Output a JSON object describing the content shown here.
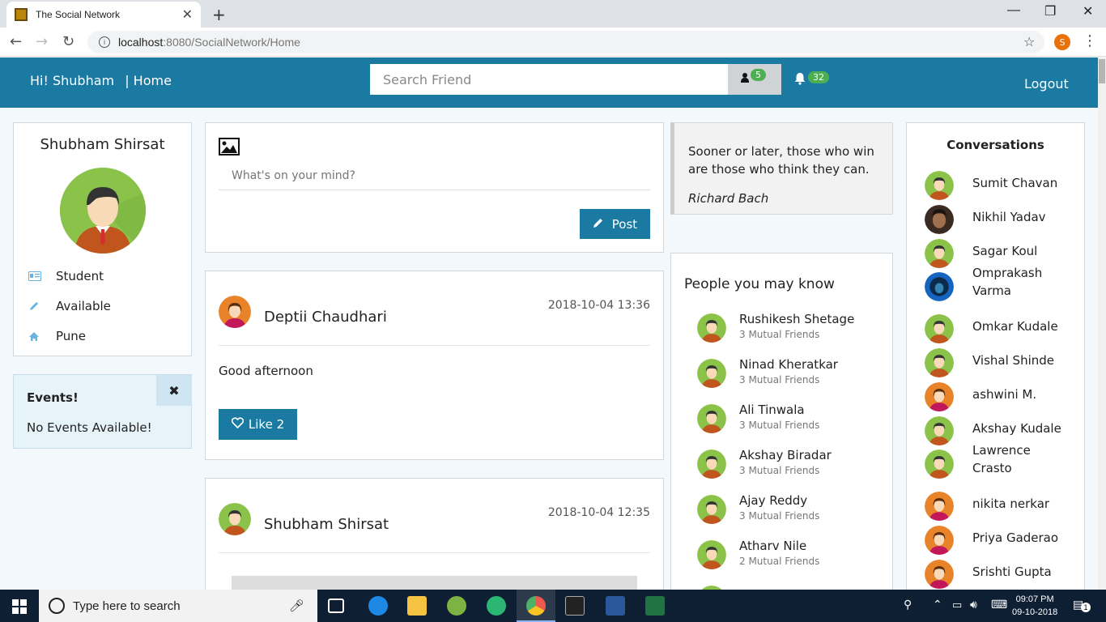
{
  "browser": {
    "tab_title": "The Social Network",
    "url_host": "localhost",
    "url_rest": ":8080/SocialNetwork/Home",
    "profile_letter": "S"
  },
  "header": {
    "greeting": "Hi! Shubham",
    "home_link": "| Home",
    "search_placeholder": "Search Friend",
    "friend_requests_count": "5",
    "notifications_count": "32",
    "logout_label": "Logout",
    "brand_color": "#1b7aa2"
  },
  "profile": {
    "name": "Shubham Shirsat",
    "occupation": "Student",
    "status": "Available",
    "city": "Pune"
  },
  "events": {
    "title": "Events!",
    "message": "No Events Available!"
  },
  "compose": {
    "placeholder": "What's on your mind?",
    "post_label": "Post"
  },
  "posts": [
    {
      "author": "Deptii Chaudhari",
      "timestamp": "2018-10-04 13:36",
      "text": "Good afternoon",
      "like_label": "Like 2"
    },
    {
      "author": "Shubham Shirsat",
      "timestamp": "2018-10-04 12:35"
    }
  ],
  "quote": {
    "text": "Sooner or later, those who win are those who think they can.",
    "author": "Richard Bach"
  },
  "people": {
    "title": "People you may know",
    "items": [
      {
        "name": "Rushikesh Shetage",
        "mutual": "3 Mutual Friends"
      },
      {
        "name": "Ninad Kheratkar",
        "mutual": "3 Mutual Friends"
      },
      {
        "name": "Ali Tinwala",
        "mutual": "3 Mutual Friends"
      },
      {
        "name": "Akshay Biradar",
        "mutual": "3 Mutual Friends"
      },
      {
        "name": "Ajay Reddy",
        "mutual": "3 Mutual Friends"
      },
      {
        "name": "Atharv Nile",
        "mutual": "2 Mutual Friends"
      }
    ]
  },
  "conversations": {
    "title": "Conversations",
    "items": [
      {
        "name": "Sumit Chavan"
      },
      {
        "name": "Nikhil Yadav"
      },
      {
        "name": "Sagar Koul"
      },
      {
        "name": "Omprakash Varma"
      },
      {
        "name": "Omkar Kudale"
      },
      {
        "name": "Vishal Shinde"
      },
      {
        "name": "ashwini M."
      },
      {
        "name": "Akshay Kudale"
      },
      {
        "name": "Lawrence Crasto"
      },
      {
        "name": "nikita nerkar"
      },
      {
        "name": "Priya Gaderao"
      },
      {
        "name": "Srishti Gupta"
      }
    ]
  },
  "taskbar": {
    "search_placeholder": "Type here to search",
    "time": "09:07 PM",
    "date": "09-10-2018",
    "notification_count": "1"
  }
}
